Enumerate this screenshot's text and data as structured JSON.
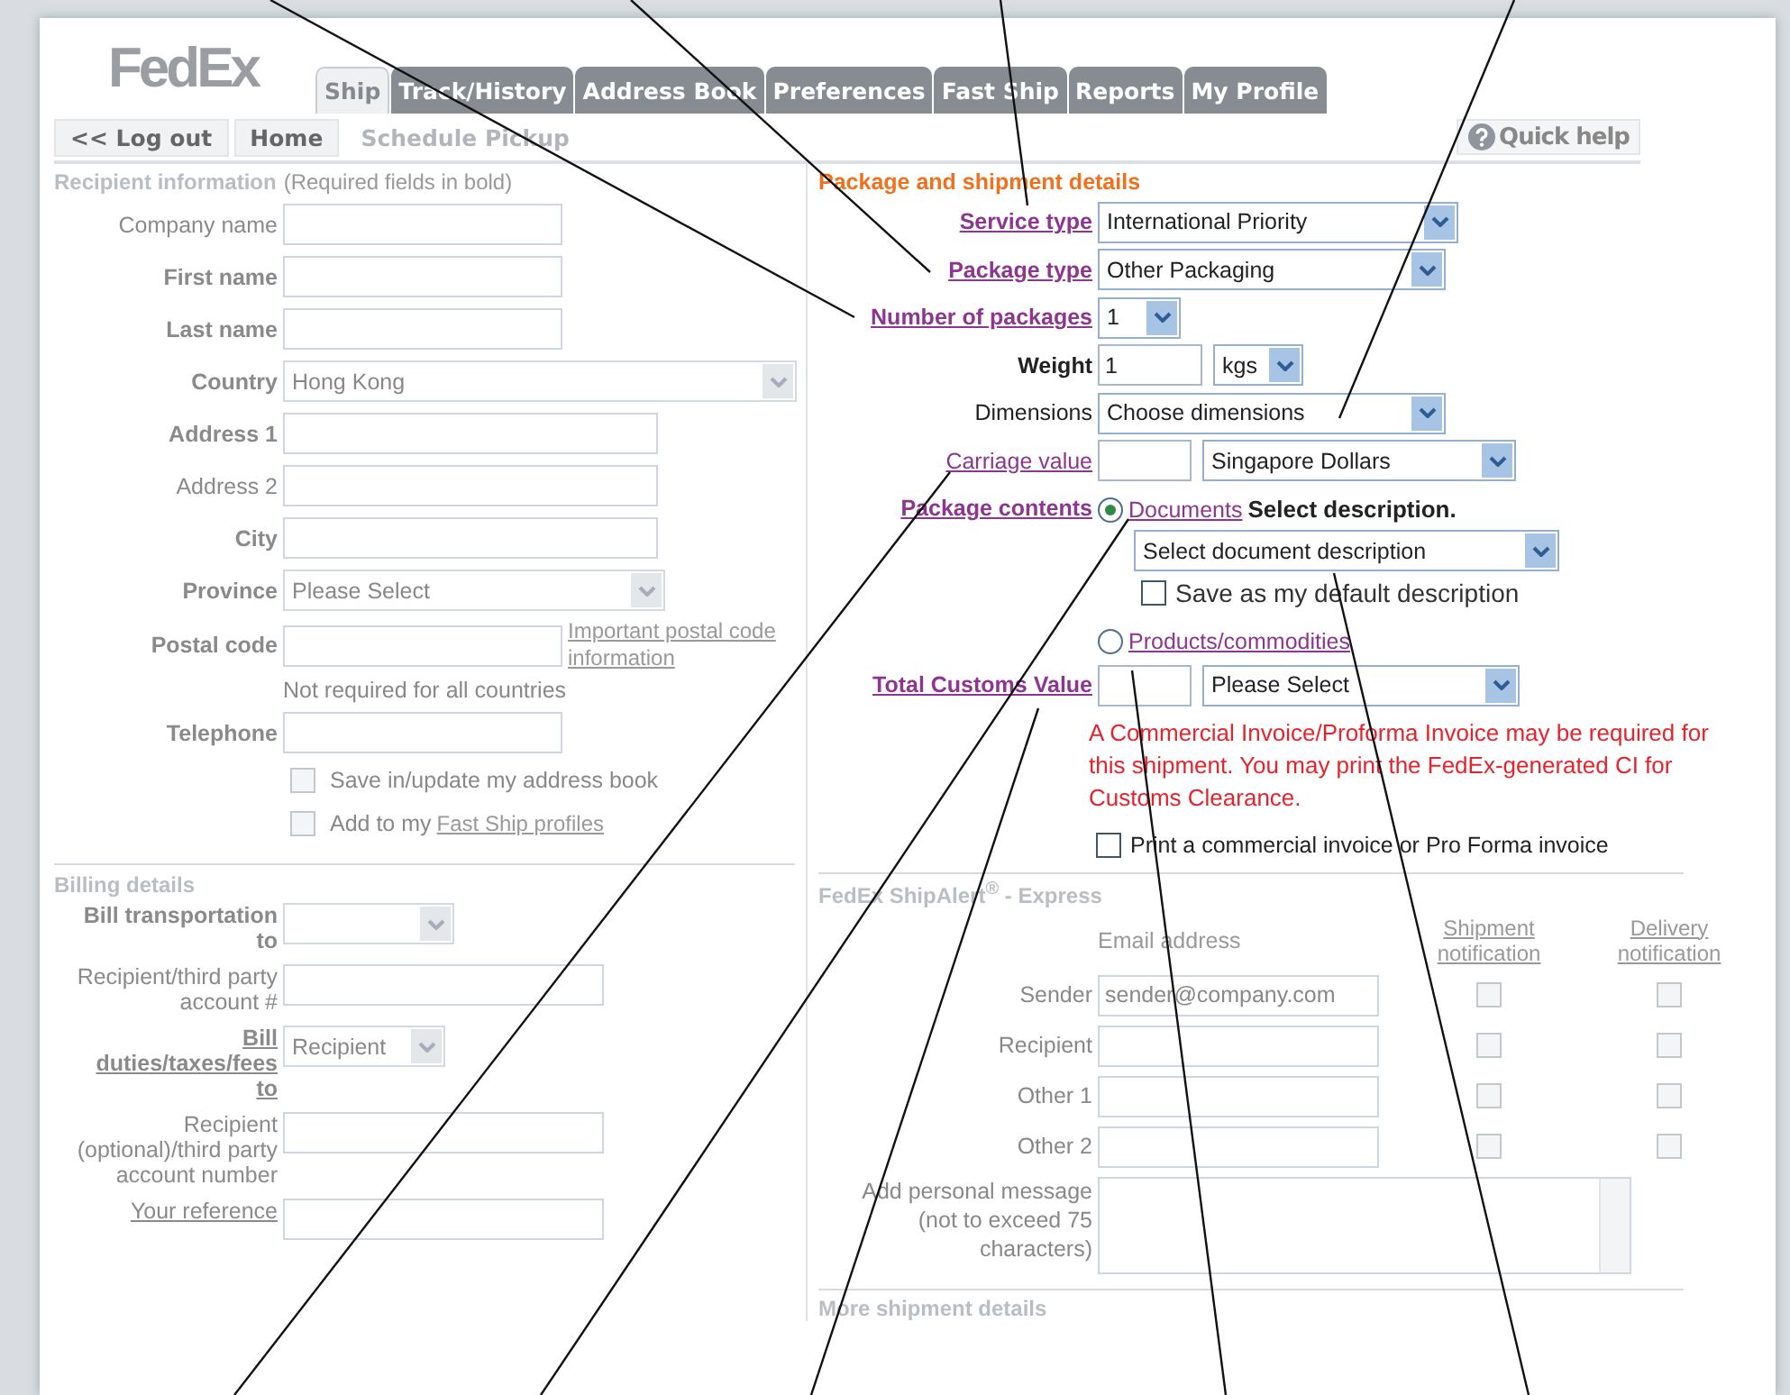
{
  "logo": "FedEx",
  "tabs": [
    {
      "label": "Ship",
      "selected": true
    },
    {
      "label": "Track/History",
      "selected": false
    },
    {
      "label": "Address Book",
      "selected": false
    },
    {
      "label": "Preferences",
      "selected": false
    },
    {
      "label": "Fast Ship",
      "selected": false
    },
    {
      "label": "Reports",
      "selected": false
    },
    {
      "label": "My Profile",
      "selected": false
    }
  ],
  "subnav": [
    {
      "label": "<< Log out",
      "disabled": false
    },
    {
      "label": "Home",
      "disabled": false
    },
    {
      "label": "Schedule Pickup",
      "disabled": true
    }
  ],
  "quick_help": "Quick help",
  "recipient": {
    "title": "Recipient information",
    "note": "(Required fields in bold)",
    "fields": [
      {
        "kind": "text",
        "label": "Company name",
        "bold_label": false,
        "underlined_label": false
      },
      {
        "kind": "text",
        "label": "First name",
        "bold_label": true,
        "underlined_label": false
      },
      {
        "kind": "text",
        "label": "Last name",
        "bold_label": true,
        "underlined_label": false
      },
      {
        "kind": "select",
        "label": "Country",
        "bold_label": true,
        "underlined_label": false,
        "value": "Hong Kong"
      },
      {
        "kind": "text",
        "label": "Address 1",
        "bold_label": true,
        "underlined_label": false
      },
      {
        "kind": "text",
        "label": "Address 2",
        "bold_label": false,
        "underlined_label": false
      },
      {
        "kind": "text",
        "label": "City",
        "bold_label": true,
        "underlined_label": false
      },
      {
        "kind": "select",
        "label": "Province",
        "bold_label": true,
        "underlined_label": false,
        "value": "Please Select"
      },
      {
        "kind": "text",
        "label": "Postal code",
        "bold_label": true,
        "underlined_label": false,
        "link": "Important postal code information"
      },
      {
        "kind": "note",
        "label": "Not required for all countries"
      },
      {
        "kind": "text",
        "label": "Telephone",
        "bold_label": true,
        "underlined_label": false
      },
      {
        "kind": "checkbox",
        "label": "Save in/update my address book",
        "checked": false
      },
      {
        "kind": "checkbox",
        "label": "Add to my",
        "link": "Fast Ship profiles",
        "checked": false
      }
    ]
  },
  "billing": {
    "title": "Billing details",
    "fields": [
      {
        "kind": "select",
        "label": "Bill transportation to",
        "bold_label": true,
        "underlined_label": false
      },
      {
        "kind": "text",
        "label": "Recipient/third party account #",
        "bold_label": false,
        "underlined_label": false
      },
      {
        "kind": "select",
        "label": "Bill duties/taxes/fees to",
        "bold_label": true,
        "underlined_label": true,
        "value": "Recipient"
      },
      {
        "kind": "text",
        "label": "Recipient (optional)/third party account number",
        "bold_label": false,
        "underlined_label": false
      },
      {
        "kind": "text",
        "label": "Your reference",
        "bold_label": false,
        "underlined_label": true
      }
    ]
  },
  "package": {
    "title": "Package and shipment details",
    "rows": [
      {
        "kind": "select",
        "label": "Service type",
        "bold_label": true,
        "underlined_label": true,
        "value": "International Priority"
      },
      {
        "kind": "select",
        "label": "Package type",
        "bold_label": true,
        "underlined_label": true,
        "value": "Other Packaging"
      },
      {
        "kind": "select",
        "label": "Number of packages",
        "bold_label": true,
        "underlined_label": true,
        "value": "1"
      },
      {
        "kind": "amount",
        "label": "Weight",
        "bold_label": true,
        "underlined_label": false,
        "value": "1",
        "unit": "kgs"
      },
      {
        "kind": "select",
        "label": "Dimensions",
        "bold_label": false,
        "underlined_label": false,
        "value": "Choose dimensions"
      },
      {
        "kind": "amount",
        "label": "Carriage value",
        "bold_label": false,
        "underlined_label": true,
        "unit": "Singapore Dollars"
      }
    ],
    "contents": {
      "label": "Package contents",
      "options": [
        {
          "label": "Documents",
          "selected": true,
          "prompt": "Select description.",
          "select": "Select document description",
          "checkbox": {
            "label": "Save as my default description",
            "checked": false
          }
        },
        {
          "label": "Products/commodities",
          "selected": false
        }
      ]
    },
    "customs": {
      "label": "Total Customs Value",
      "unit": "Please Select"
    },
    "warning": "A Commercial Invoice/Proforma Invoice may be required for this shipment. You may print the FedEx-generated CI for Customs Clearance.",
    "print_invoice": {
      "label": "Print a commercial invoice or Pro Forma invoice",
      "checked": false
    }
  },
  "shipalert": {
    "title": "FedEx ShipAlert$^{®}$ - Express",
    "columns": [
      "Email address",
      "Shipment notification",
      "Delivery notification"
    ],
    "rows": [
      {
        "label": "Sender",
        "value": "sender@company.com",
        "shipment": false,
        "delivery": false
      },
      {
        "label": "Recipient",
        "shipment": false,
        "delivery": false
      },
      {
        "label": "Other 1",
        "shipment": false,
        "delivery": false
      },
      {
        "label": "Other 2",
        "shipment": false,
        "delivery": false
      }
    ],
    "message_label": "Add personal message (not to exceed 75 characters)"
  },
  "more_title": "More shipment details"
}
